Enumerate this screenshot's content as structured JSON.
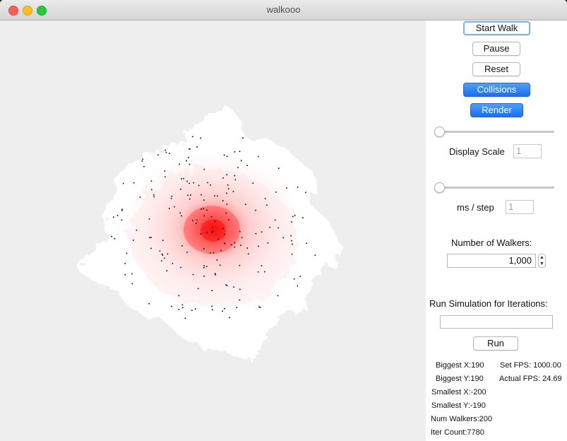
{
  "window": {
    "title": "walkooo"
  },
  "controls": {
    "start_walk": "Start Walk",
    "pause": "Pause",
    "reset": "Reset",
    "collisions": "Collisions",
    "render": "Render",
    "display_scale_label": "Display Scale",
    "display_scale_value": "1",
    "ms_step_label": "ms  / step",
    "ms_step_value": "1",
    "num_walkers_label": "Number of Walkers:",
    "num_walkers_value": "1,000",
    "run_iterations_label": "Run Simulation for Iterations:",
    "run_iterations_value": "",
    "run": "Run"
  },
  "sliders": {
    "display_scale_fraction": 0.0,
    "ms_step_fraction": 0.0
  },
  "stats": {
    "biggest_x": "Biggest X:190",
    "biggest_y": "Biggest Y:190",
    "smallest_x": "Smallest X:-200",
    "smallest_y": "Smallest Y:-190",
    "num_walkers": "Num Walkers:200",
    "iter_count": "Iter Count:7780",
    "set_fps": "Set FPS: 1000.00",
    "actual_fps": "Actual FPS: 24.69"
  },
  "colors": {
    "accent_blue": "#1a6ff0",
    "heat_red": "#ff0000",
    "walker_dot": "#000000"
  }
}
